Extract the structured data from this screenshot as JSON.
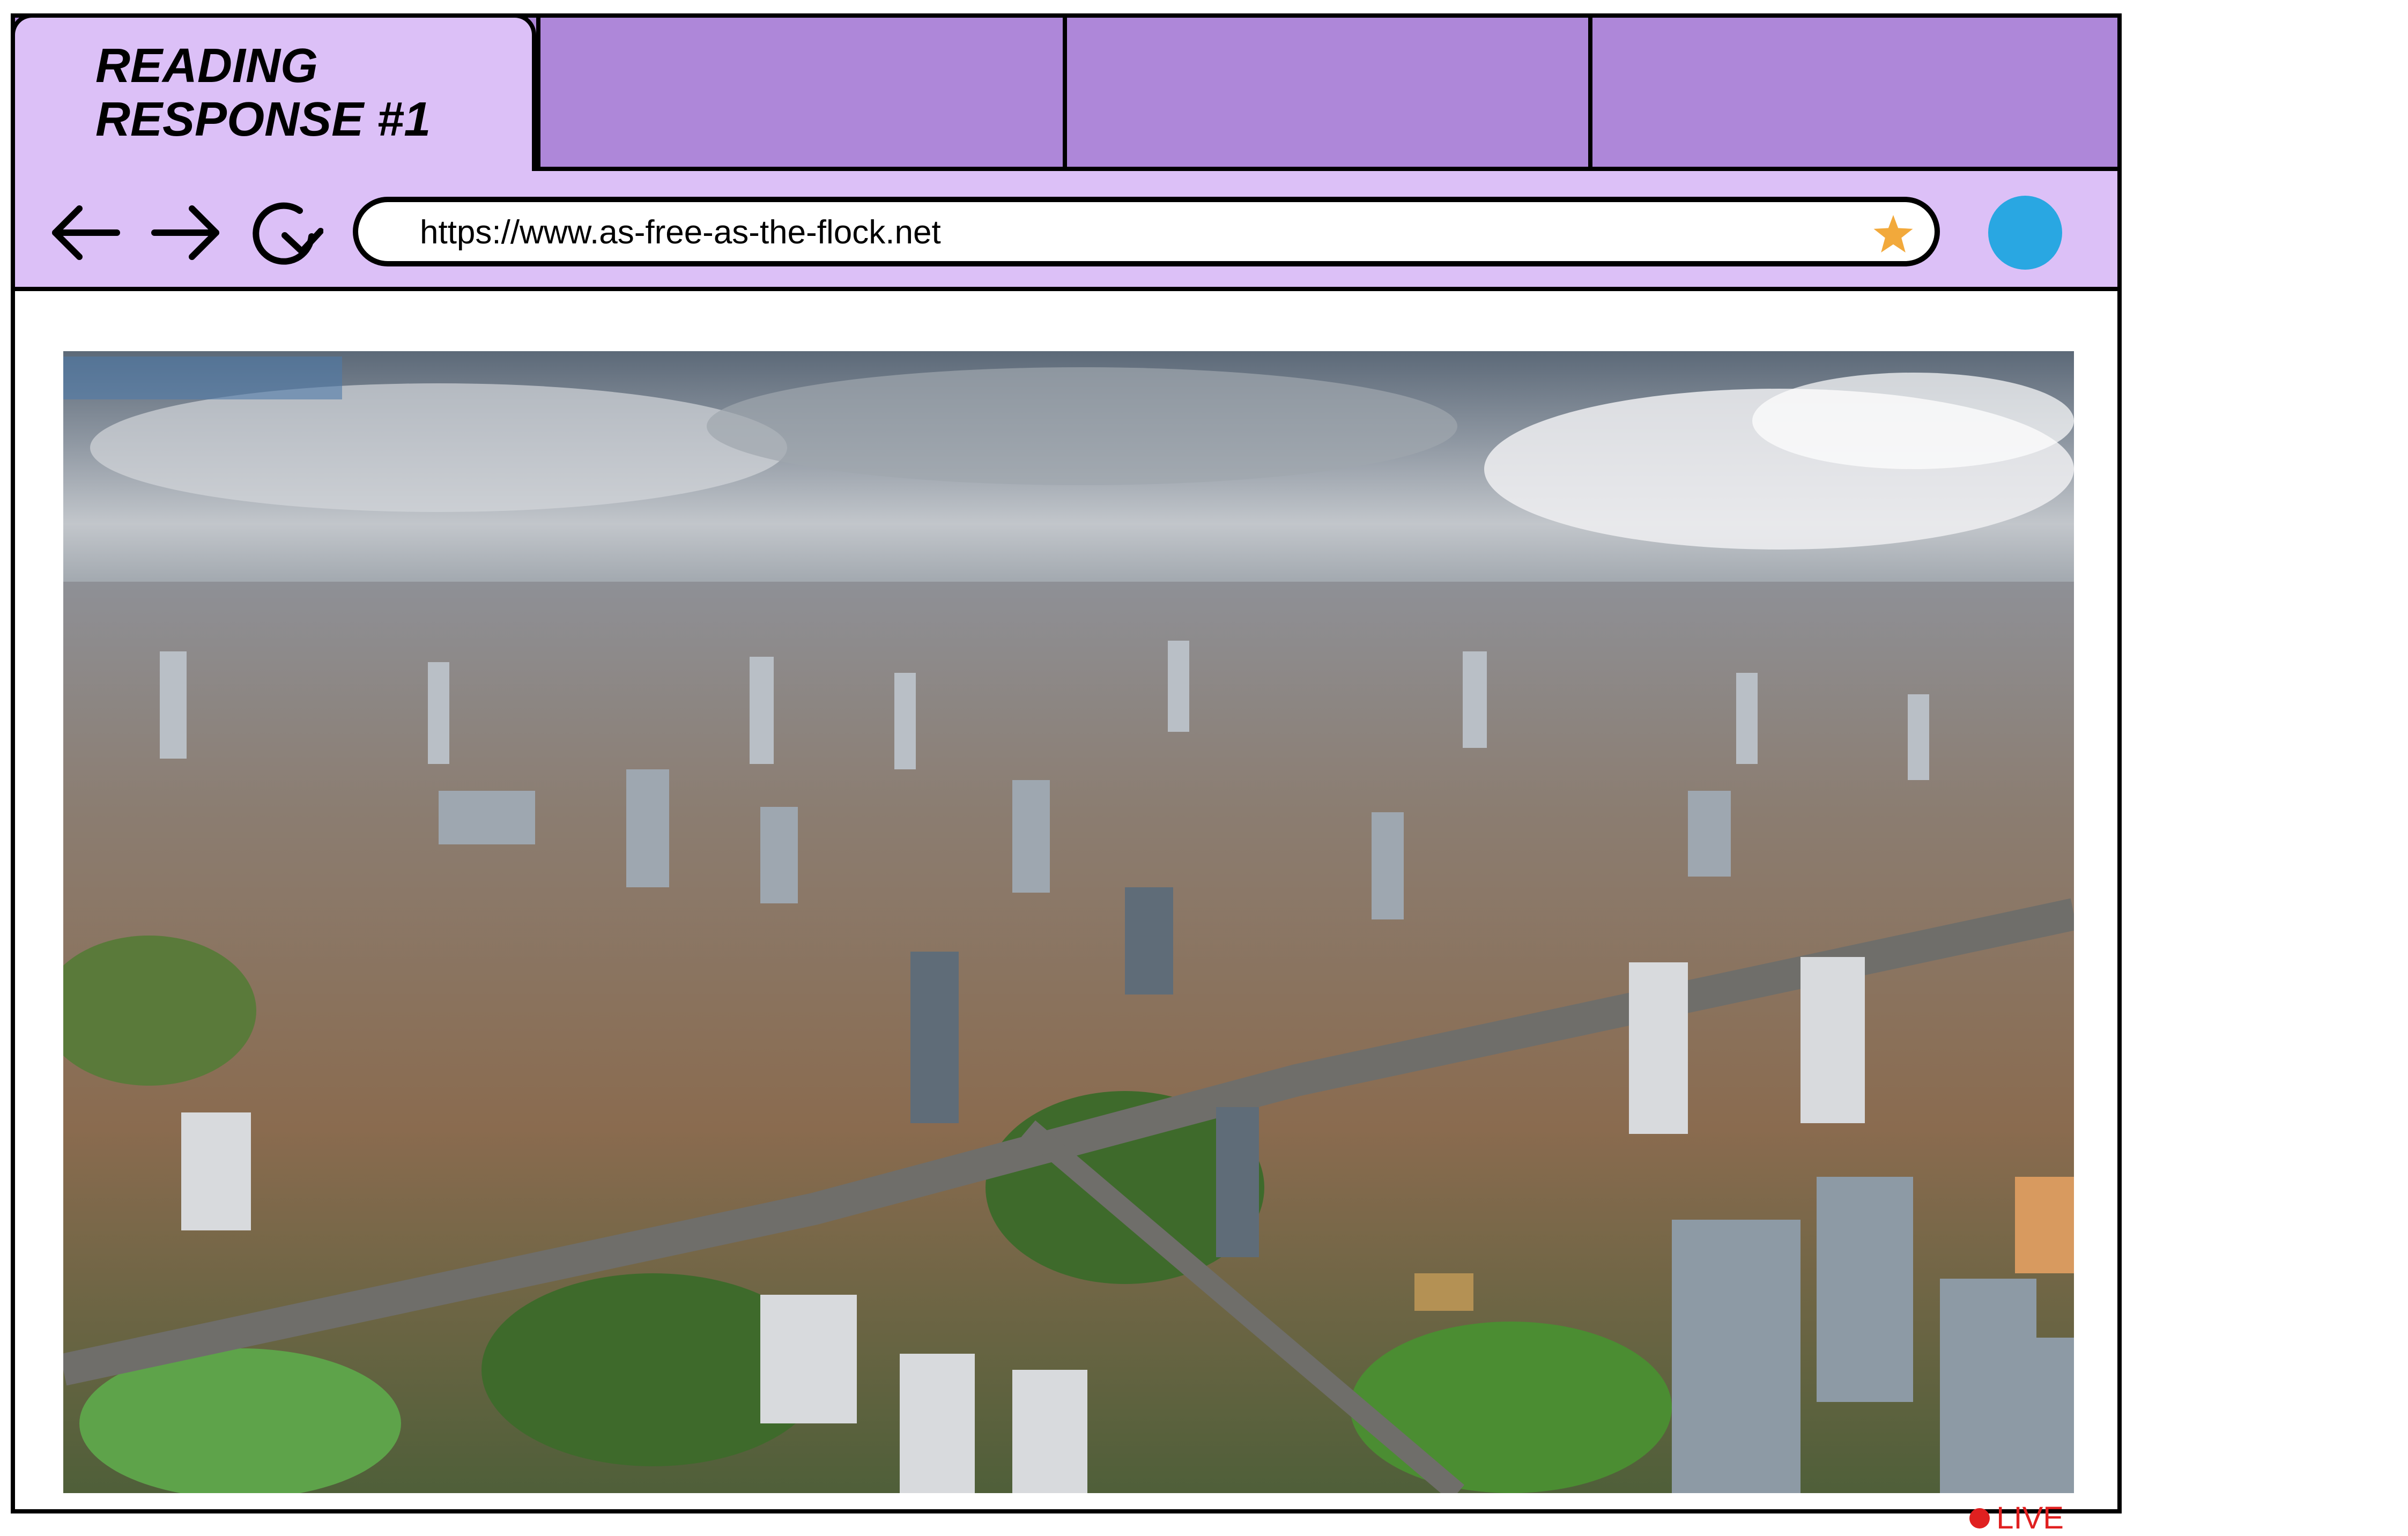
{
  "tabs": [
    {
      "label": "READING\nRESPONSE #1",
      "active": true
    },
    {
      "label": ""
    },
    {
      "label": ""
    },
    {
      "label": ""
    }
  ],
  "toolbar": {
    "back": "back-arrow-icon",
    "forward": "forward-arrow-icon",
    "reload": "reload-icon",
    "url": "https://www.as-free-as-the-flock.net",
    "bookmark": "star-icon",
    "profile": "profile-circle-icon"
  },
  "content": {
    "image_subject": "aerial-city-skyline-photo",
    "live_label": "LIVE"
  },
  "colors": {
    "tab_bar": "#ae87d9",
    "active_tab": "#dcc0f7",
    "toolbar": "#dcc0f7",
    "profile": "#29a7e2",
    "star": "#f2a93b",
    "live": "#e02020"
  }
}
